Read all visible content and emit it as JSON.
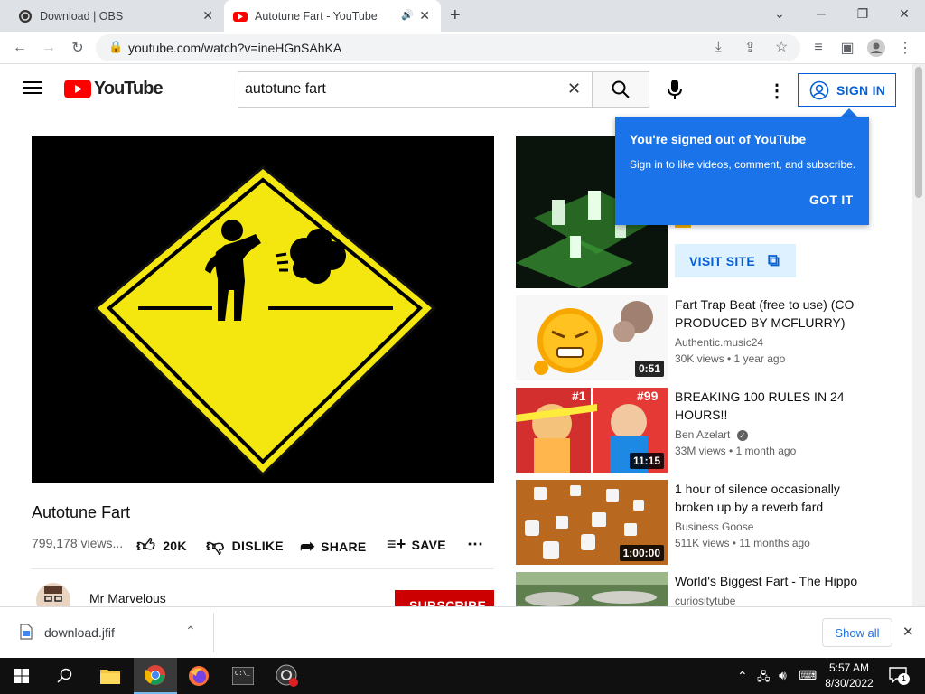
{
  "browser": {
    "tabs": [
      {
        "title": "Download | OBS"
      },
      {
        "title": "Autotune Fart - YouTube"
      }
    ],
    "url": "youtube.com/watch?v=ineHGnSAhKA"
  },
  "youtube": {
    "logo_text": "YouTube",
    "search_value": "autotune fart",
    "sign_in_label": "SIGN IN"
  },
  "video": {
    "title": "Autotune Fart",
    "views": "799,178 views...",
    "likes": "20K",
    "dislike_label": "DISLIKE",
    "share_label": "SHARE",
    "save_label": "SAVE",
    "channel": "Mr Marvelous",
    "subscribe_label": "SUBSCRIBE"
  },
  "popup": {
    "title": "You're signed out of YouTube",
    "body": "Sign in to like videos, comment, and subscribe.",
    "button": "GOT IT"
  },
  "ad": {
    "visit_label": "VISIT SITE"
  },
  "recommendations": [
    {
      "title": "Fart Trap Beat (free to use) (CO PRODUCED BY MCFLURRY)",
      "channel": "Authentic.music24",
      "views": "30K views • 1 year ago",
      "duration": "0:51"
    },
    {
      "title": "BREAKING 100 RULES IN 24 HOURS!!",
      "channel": "Ben Azelart",
      "views": "33M views • 1 month ago",
      "duration": "11:15"
    },
    {
      "title": "1 hour of silence occasionally broken up by a reverb fard",
      "channel": "Business Goose",
      "views": "511K views • 11 months ago",
      "duration": "1:00:00"
    },
    {
      "title": "World's Biggest Fart - The Hippo",
      "channel": "curiositytube",
      "views": "",
      "duration": ""
    }
  ],
  "download_bar": {
    "filename": "download.jfif",
    "show_all": "Show all"
  },
  "taskbar": {
    "time": "5:57 AM",
    "date": "8/30/2022",
    "notification_count": "1"
  },
  "colors": {
    "youtube_red": "#ff0000",
    "accent_blue": "#1a73e8",
    "sign_in_blue": "#065fd4"
  }
}
